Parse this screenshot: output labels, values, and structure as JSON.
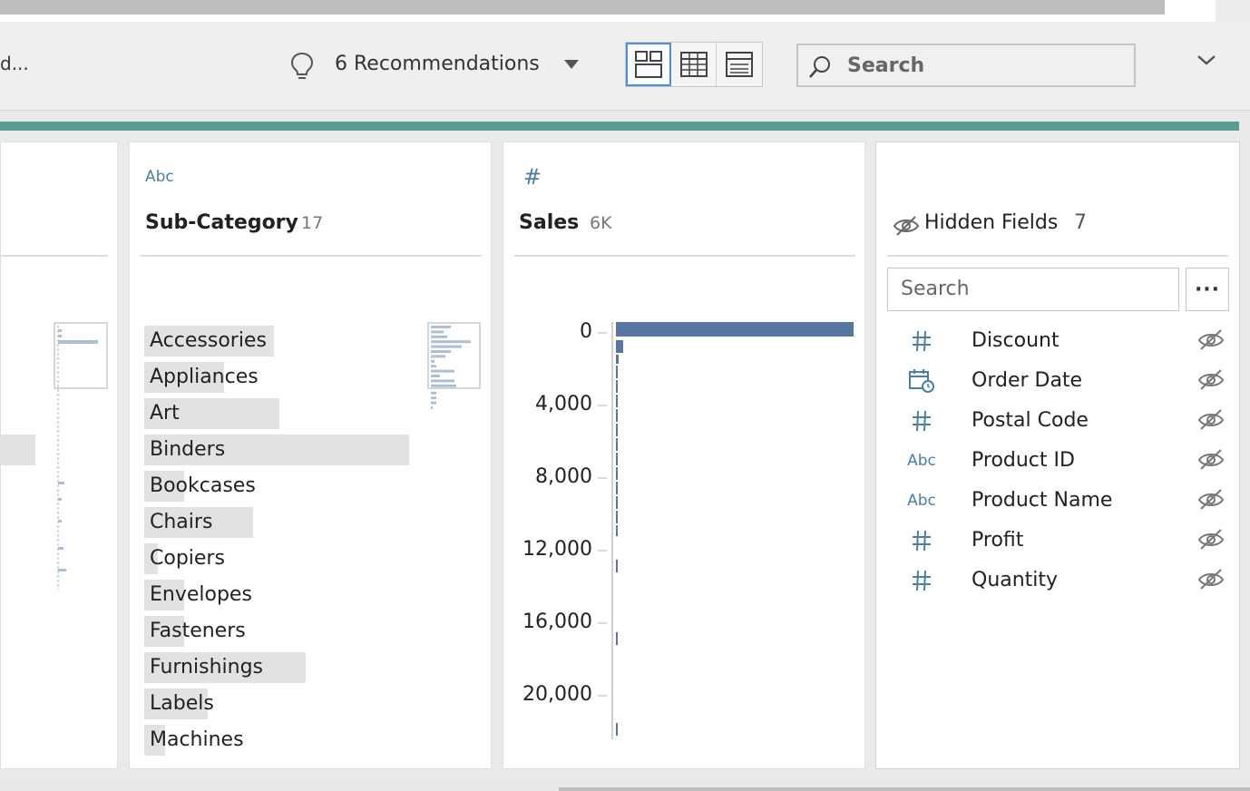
{
  "toolbar": {
    "left_text": "d...",
    "recommendations_label": "6 Recommendations",
    "search_placeholder": "Search"
  },
  "subcategory": {
    "type_label": "Abc",
    "title": "Sub-Category",
    "count": "17",
    "items": [
      {
        "label": "Accessories",
        "fill": 0.49
      },
      {
        "label": "Appliances",
        "fill": 0.3
      },
      {
        "label": "Art",
        "fill": 0.51
      },
      {
        "label": "Binders",
        "fill": 1.0
      },
      {
        "label": "Bookcases",
        "fill": 0.15
      },
      {
        "label": "Chairs",
        "fill": 0.41
      },
      {
        "label": "Copiers",
        "fill": 0.05
      },
      {
        "label": "Envelopes",
        "fill": 0.15
      },
      {
        "label": "Fasteners",
        "fill": 0.15
      },
      {
        "label": "Furnishings",
        "fill": 0.61
      },
      {
        "label": "Labels",
        "fill": 0.24
      },
      {
        "label": "Machines",
        "fill": 0.08
      }
    ]
  },
  "sales": {
    "type_label": "#",
    "title": "Sales",
    "count": "6K",
    "ticks": [
      "0",
      "4,000",
      "8,000",
      "12,000",
      "16,000",
      "20,000"
    ]
  },
  "hidden_fields": {
    "title": "Hidden Fields",
    "count": "7",
    "search_placeholder": "Search",
    "more_label": "···",
    "items": [
      {
        "name": "Discount",
        "type": "number",
        "type_label": "#"
      },
      {
        "name": "Order Date",
        "type": "date",
        "type_label": ""
      },
      {
        "name": "Postal Code",
        "type": "number",
        "type_label": "#"
      },
      {
        "name": "Product ID",
        "type": "string",
        "type_label": "Abc"
      },
      {
        "name": "Product Name",
        "type": "string",
        "type_label": "Abc"
      },
      {
        "name": "Profit",
        "type": "number",
        "type_label": "#"
      },
      {
        "name": "Quantity",
        "type": "number",
        "type_label": "#"
      }
    ]
  },
  "colors": {
    "accent_teal": "#5a9b94",
    "field_type_blue": "#4a7fa5",
    "histogram_bar": "#5677a3",
    "category_bar": "#e2e2e2"
  }
}
